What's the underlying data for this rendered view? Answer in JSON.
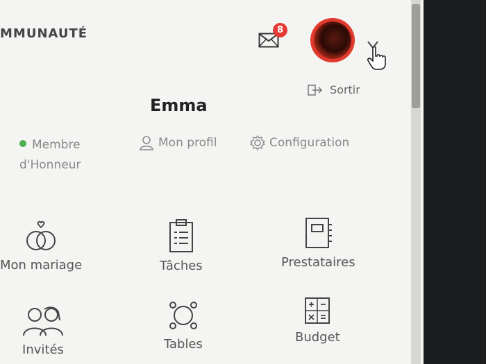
{
  "header": {
    "title": "MMUNAUTÉ",
    "messages_badge": "8"
  },
  "user": {
    "name": "Emma",
    "logout_label": "Sortir",
    "status_line1": "Membre",
    "status_line2": "d'Honneur",
    "profile_label": "Mon profil",
    "config_label": "Configuration"
  },
  "tiles": [
    {
      "label": "Mon mariage",
      "icon": "rings-icon"
    },
    {
      "label": "Tâches",
      "icon": "clipboard-icon"
    },
    {
      "label": "Prestataires",
      "icon": "notebook-icon"
    },
    {
      "label": "Invités",
      "icon": "guests-icon"
    },
    {
      "label": "Tables",
      "icon": "table-icon"
    },
    {
      "label": "Budget",
      "icon": "calculator-icon"
    }
  ],
  "colors": {
    "badge": "#e53935",
    "status_dot": "#4caf50",
    "avatar_ring": "#e03a2f"
  }
}
